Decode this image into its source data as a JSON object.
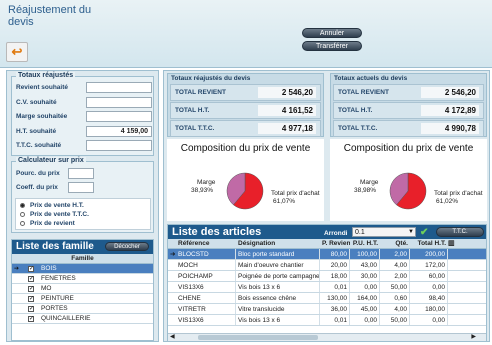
{
  "header": {
    "title": "Réajustement du devis",
    "cancel_label": "Annuler",
    "transfer_label": "Transférer"
  },
  "left": {
    "totaux_title": "Totaux réajustés",
    "totaux_rows": [
      {
        "label": "Revient souhaité",
        "value": ""
      },
      {
        "label": "C.V. souhaité",
        "value": ""
      },
      {
        "label": "Marge souhaitée",
        "value": ""
      },
      {
        "label": "H.T. souhaité",
        "value": "4 159,00"
      },
      {
        "label": "T.T.C. souhaité",
        "value": ""
      }
    ],
    "calc_title": "Calculateur sur prix",
    "calc_rows": [
      {
        "label": "Pourc. du prix",
        "value": ""
      },
      {
        "label": "Coeff. du prix",
        "value": ""
      }
    ],
    "radios": [
      {
        "label": "Prix de vente H.T.",
        "selected": true
      },
      {
        "label": "Prix de vente T.T.C.",
        "selected": false
      },
      {
        "label": "Prix de revient",
        "selected": false
      }
    ],
    "families_title": "Liste des famille",
    "uncheck_label": "Décocher",
    "families_col": "Famille",
    "families": [
      "BOIS",
      "FENETRES",
      "MO",
      "PEINTURE",
      "PORTES",
      "QUINCAILLERIE"
    ]
  },
  "totals_readjusted": {
    "title": "Totaux réajustés du devis",
    "rows": [
      {
        "label": "TOTAL REVIENT",
        "value": "2 546,20"
      },
      {
        "label": "TOTAL H.T.",
        "value": "4 161,52"
      },
      {
        "label": "TOTAL T.T.C.",
        "value": "4 977,18"
      }
    ]
  },
  "totals_current": {
    "title": "Totaux actuels du devis",
    "rows": [
      {
        "label": "TOTAL REVIENT",
        "value": "2 546,20"
      },
      {
        "label": "TOTAL H.T.",
        "value": "4 172,89"
      },
      {
        "label": "TOTAL T.T.C.",
        "value": "4 990,78"
      }
    ]
  },
  "charts": [
    {
      "title": "Composition du prix de vente",
      "marge_label": "Marge",
      "marge_pct": "38,93%",
      "achat_label": "Total prix d'achat",
      "achat_pct": "61,07%",
      "marge_value": 38.93
    },
    {
      "title": "Composition du prix de vente",
      "marge_label": "Marge",
      "marge_pct": "38,98%",
      "achat_label": "Total prix d'achat",
      "achat_pct": "61,02%",
      "marge_value": 38.98
    }
  ],
  "colors": {
    "achat": "#e8202a",
    "marge": "#c06aa6"
  },
  "articles": {
    "title": "Liste des articles",
    "arrondi_label": "Arrondi",
    "arrondi_value": "0.1",
    "ttc_label": "T.T.C.",
    "columns": [
      "Référence",
      "Désignation",
      "P. Revient",
      "P.U. H.T.",
      "Qté.",
      "Total H.T."
    ],
    "rows": [
      [
        "BLOCSTD",
        "Bloc porte standard",
        "80,00",
        "100,00",
        "2,00",
        "200,00"
      ],
      [
        "MOCH",
        "Main d'oeuvre chantier",
        "20,00",
        "43,00",
        "4,00",
        "172,00"
      ],
      [
        "POICHAMP",
        "Poignée de porte campagne",
        "18,00",
        "30,00",
        "2,00",
        "60,00"
      ],
      [
        "VIS13X6",
        "Vis bois 13 x 6",
        "0,01",
        "0,00",
        "50,00",
        "0,00"
      ],
      [
        "CHENE",
        "Bois essence chêne",
        "130,00",
        "164,00",
        "0,60",
        "98,40"
      ],
      [
        "VITRETR",
        "Vitre translucide",
        "36,00",
        "45,00",
        "4,00",
        "180,00"
      ],
      [
        "VIS13X6",
        "Vis bois 13 x 6",
        "0,01",
        "0,00",
        "50,00",
        "0,00"
      ]
    ]
  }
}
